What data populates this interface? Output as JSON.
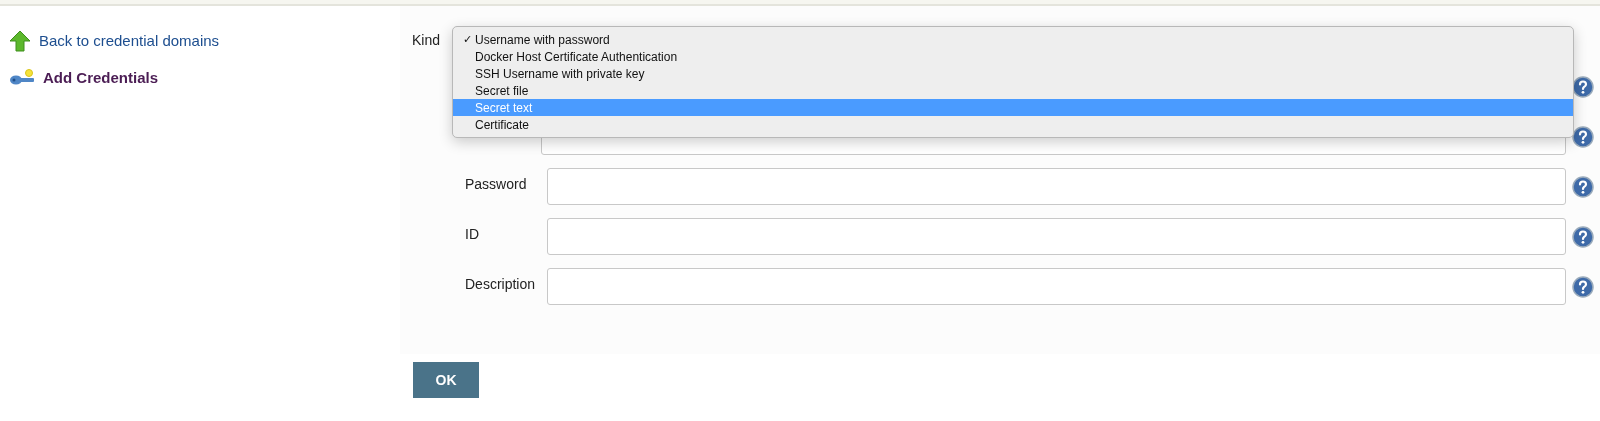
{
  "sidebar": {
    "items": [
      {
        "kind": "link",
        "label": "Back to credential domains"
      },
      {
        "kind": "current",
        "label": "Add Credentials"
      }
    ]
  },
  "form": {
    "kind_label": "Kind",
    "kind_menu": [
      {
        "label": "Username with password",
        "checked": true,
        "highlighted": false
      },
      {
        "label": "Docker Host Certificate Authentication",
        "checked": false,
        "highlighted": false
      },
      {
        "label": "SSH Username with private key",
        "checked": false,
        "highlighted": false
      },
      {
        "label": "Secret file",
        "checked": false,
        "highlighted": false
      },
      {
        "label": "Secret text",
        "checked": false,
        "highlighted": true
      },
      {
        "label": "Certificate",
        "checked": false,
        "highlighted": false
      }
    ],
    "check_mark": "✓",
    "hidden_rows": [
      {
        "kind": "help"
      },
      {
        "kind": "text"
      }
    ],
    "fields": [
      {
        "label": "Password"
      },
      {
        "label": "ID"
      },
      {
        "label": "Description"
      }
    ]
  },
  "buttons": [
    "OK"
  ]
}
